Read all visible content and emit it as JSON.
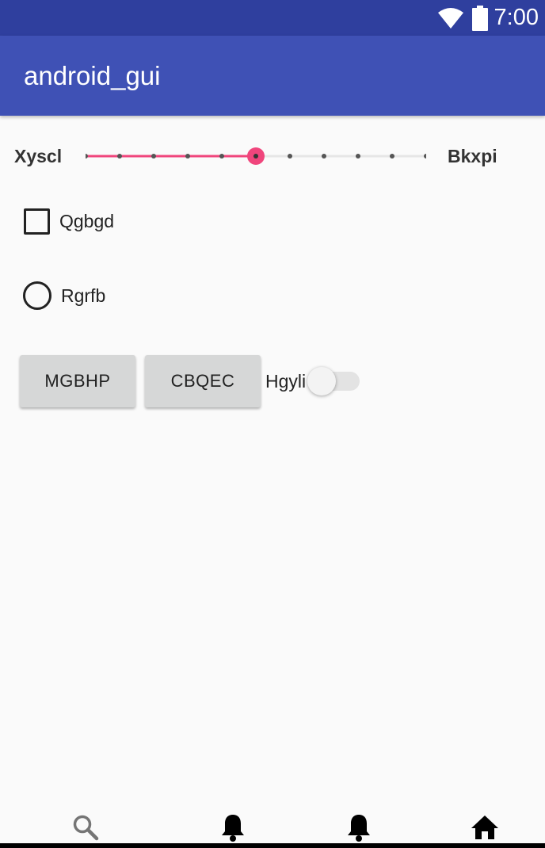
{
  "status_bar": {
    "time": "7:00",
    "icons": [
      "wifi-icon",
      "battery-icon"
    ],
    "color": "#2f3f9e"
  },
  "app_bar": {
    "title": "android_gui",
    "color": "#3f51b5"
  },
  "slider": {
    "min_label": "Xyscl",
    "max_label": "Bkxpi",
    "steps": 10,
    "value": 5,
    "accent_color": "#f0457c"
  },
  "checkbox": {
    "label": "Qgbgd",
    "checked": false
  },
  "radio": {
    "label": "Rgrfb",
    "selected": false
  },
  "buttons": {
    "first": "MGBHP",
    "second": "CBQEC"
  },
  "switch": {
    "label": "Hgyli",
    "on": false
  },
  "bottom_nav": {
    "items": [
      "search-icon",
      "bell-icon",
      "bell-icon",
      "home-icon"
    ]
  }
}
